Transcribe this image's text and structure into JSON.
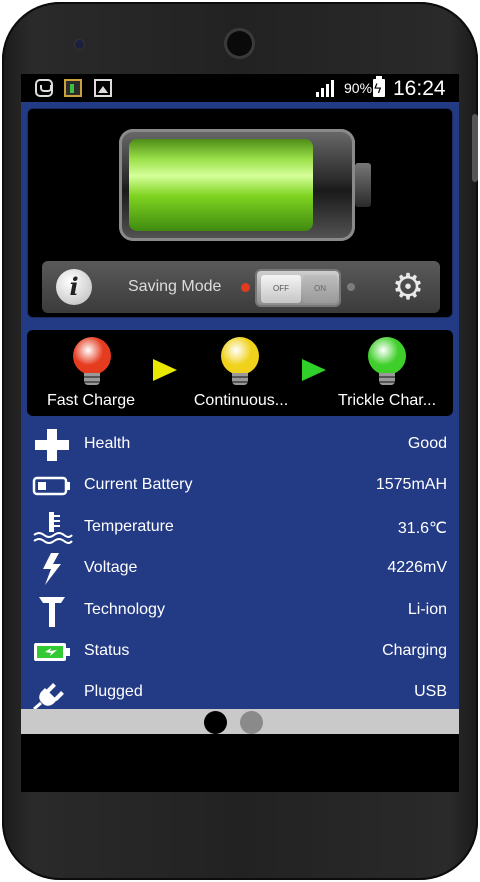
{
  "status_bar": {
    "battery_percent": "90%",
    "time": "16:24",
    "left_icons": [
      "android-notification-icon",
      "battery-app-icon",
      "gallery-icon"
    ]
  },
  "battery_panel": {
    "charge_level": 0.9,
    "saving_mode_label": "Saving Mode",
    "toggle_off_text": "OFF",
    "toggle_on_text": "ON",
    "saving_mode_state": "off"
  },
  "charge_stages": [
    {
      "label": "Fast Charge",
      "color": "#e53b1f"
    },
    {
      "label": "Continuous...",
      "color": "#f0d21c"
    },
    {
      "label": "Trickle Char...",
      "color": "#3fcf2a"
    }
  ],
  "stage_arrow_colors": [
    "#e9e900",
    "#2fd12a"
  ],
  "info_rows": [
    {
      "icon": "plus-health-icon",
      "label": "Health",
      "value": "Good"
    },
    {
      "icon": "battery-outline-icon",
      "label": "Current Battery",
      "value": "1575mAH"
    },
    {
      "icon": "thermometer-icon",
      "label": "Temperature",
      "value": "31.6℃"
    },
    {
      "icon": "lightning-icon",
      "label": "Voltage",
      "value": "4226mV"
    },
    {
      "icon": "hammer-icon",
      "label": "Technology",
      "value": "Li-ion"
    },
    {
      "icon": "charging-battery-icon",
      "label": "Status",
      "value": "Charging"
    },
    {
      "icon": "plug-icon",
      "label": "Plugged",
      "value": "USB"
    }
  ],
  "pager": {
    "active_index": 0,
    "count": 2,
    "active_color": "#000000",
    "inactive_color": "#8a8a8a"
  },
  "colors": {
    "panel_blue": "#233a85",
    "battery_green": "#7ed320"
  }
}
